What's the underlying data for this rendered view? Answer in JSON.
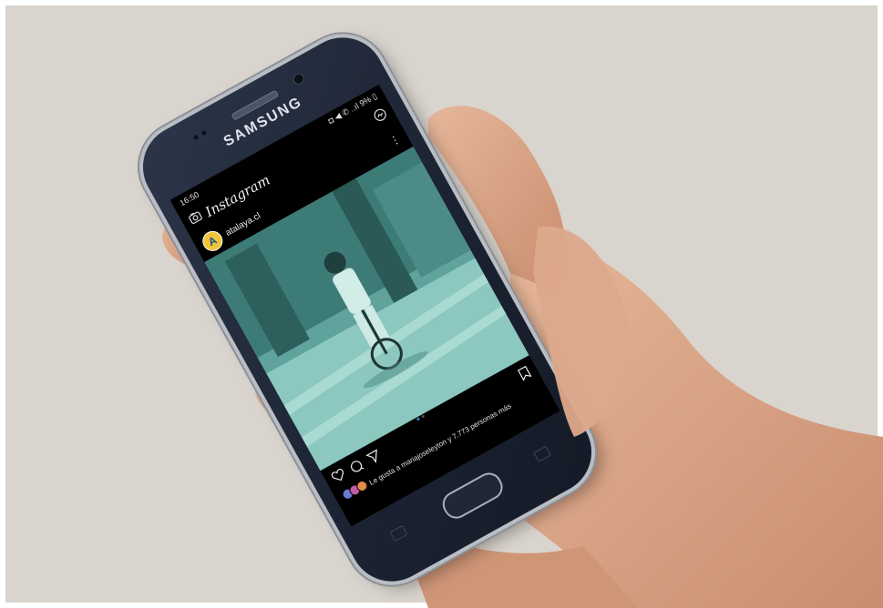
{
  "phone": {
    "brand": "SAMSUNG"
  },
  "status": {
    "time": "16:50",
    "right": "◘ ◀ ✆ ..ıl 9% ▯"
  },
  "app": {
    "name": "Instagram"
  },
  "post": {
    "avatar_letter": "A",
    "username": "atalaya.cl",
    "likes_text": "Le gusta a mariajoseleyton y 7.773 personas más"
  },
  "icons": {
    "camera": "camera-icon",
    "messenger": "messenger-icon",
    "more": "more-vertical-icon",
    "heart": "heart-icon",
    "comment": "comment-icon",
    "share": "send-icon",
    "bookmark": "bookmark-icon"
  },
  "colors": {
    "background": "#d9d4cd",
    "photo_tint": "#6fb0a9",
    "phone_body": "#1b2232"
  }
}
